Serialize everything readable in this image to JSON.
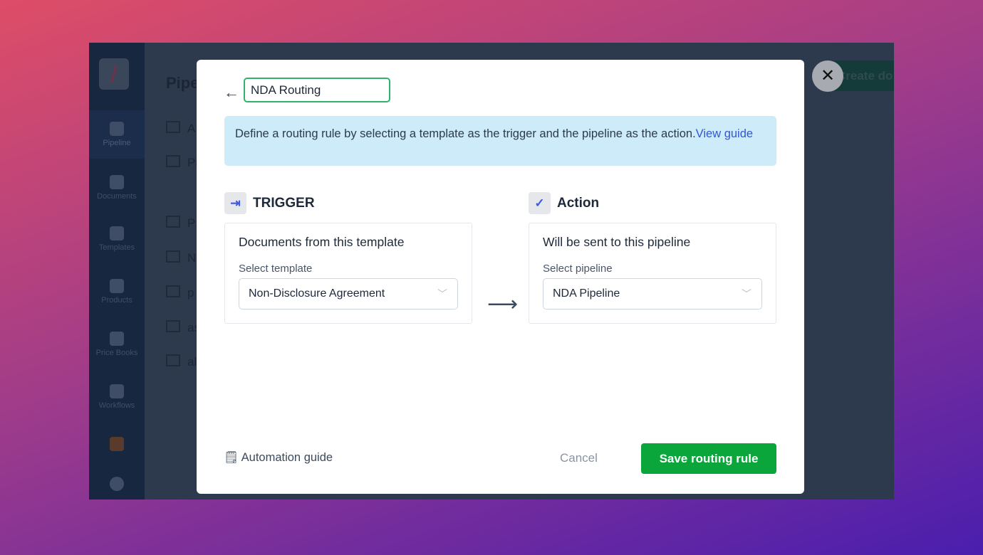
{
  "sidebar": {
    "items": [
      {
        "label": "Pipeline"
      },
      {
        "label": "Documents"
      },
      {
        "label": "Templates"
      },
      {
        "label": "Products"
      },
      {
        "label": "Price Books"
      },
      {
        "label": "Workflows"
      }
    ]
  },
  "background": {
    "title": "Pipe",
    "create_label": "Create do",
    "rows": [
      "A",
      "Pi",
      "P",
      "N",
      "p",
      "as",
      "al"
    ]
  },
  "modal": {
    "back_icon": "arrow-left-icon",
    "name_value": "NDA Routing",
    "info_text": "Define a routing rule by selecting a template as the trigger and the pipeline as the action.",
    "info_link": "View guide",
    "trigger": {
      "heading": "TRIGGER",
      "card_title": "Documents from this template",
      "label": "Select template",
      "value": "Non-Disclosure Agreement"
    },
    "action": {
      "heading": "Action",
      "card_title": "Will be sent to this pipeline",
      "label": "Select pipeline",
      "value": "NDA Pipeline"
    },
    "guide_label": "Automation guide",
    "cancel_label": "Cancel",
    "save_label": "Save routing rule"
  },
  "colors": {
    "accent": "#0aa63c",
    "info_bg": "#cdebf8",
    "link": "#3057d5"
  }
}
